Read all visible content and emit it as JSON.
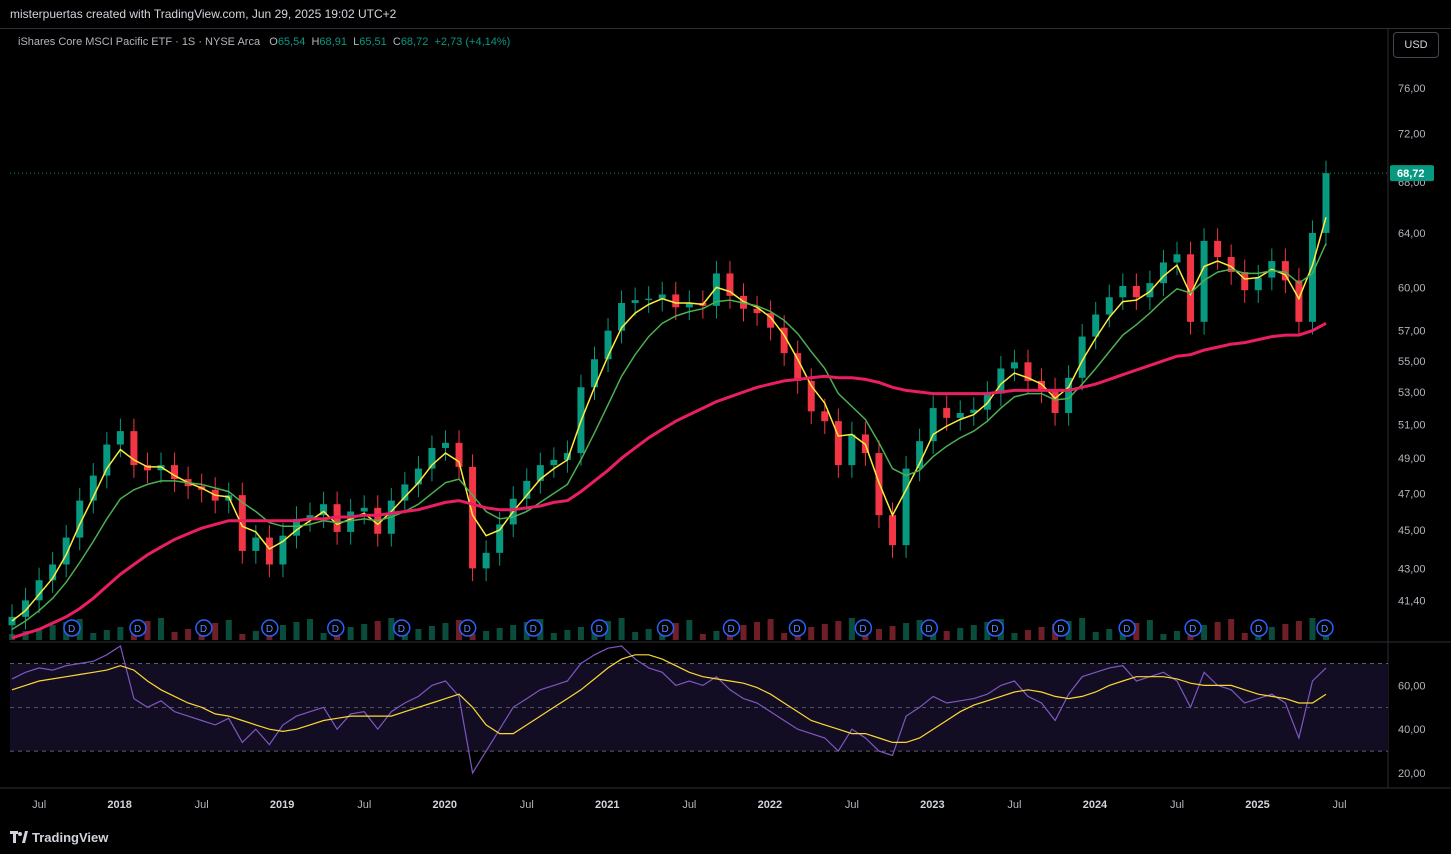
{
  "header": {
    "credit": "misterpuertas created with TradingView.com, Jun 29, 2025 19:02 UTC+2"
  },
  "legend": {
    "symbol": "iShares Core MSCI Pacific ETF · 1S · NYSE Arca",
    "open_label": "O",
    "open": "65,54",
    "high_label": "H",
    "high": "68,91",
    "low_label": "L",
    "low": "65,51",
    "close_label": "C",
    "close": "68,72",
    "change": "+2,73 (+4,14%)"
  },
  "currency": "USD",
  "footer": {
    "brand": "TradingView"
  },
  "colors": {
    "up": "#089981",
    "down": "#f23645",
    "ema_fast": "#2962ff",
    "ema_mid": "#ffeb3b",
    "ema_slow": "#4caf50",
    "ema_long": "#e91e63",
    "rsi": "#7e57c2",
    "rsi_ma": "#fdd835"
  },
  "chart_data": [
    {
      "type": "line",
      "title": "",
      "x": [
        "2017-05",
        "2017-06",
        "2017-07",
        "2017-08",
        "2017-09",
        "2017-10",
        "2017-11",
        "2017-12",
        "2018-01",
        "2018-02",
        "2018-03",
        "2018-04",
        "2018-05",
        "2018-06",
        "2018-07",
        "2018-08",
        "2018-09",
        "2018-10",
        "2018-11",
        "2018-12",
        "2019-01",
        "2019-02",
        "2019-03",
        "2019-04",
        "2019-05",
        "2019-06",
        "2019-07",
        "2019-08",
        "2019-09",
        "2019-10",
        "2019-11",
        "2019-12",
        "2020-01",
        "2020-02",
        "2020-03",
        "2020-04",
        "2020-05",
        "2020-06",
        "2020-07",
        "2020-08",
        "2020-09",
        "2020-10",
        "2020-11",
        "2020-12",
        "2021-01",
        "2021-02",
        "2021-03",
        "2021-04",
        "2021-05",
        "2021-06",
        "2021-07",
        "2021-08",
        "2021-09",
        "2021-10",
        "2021-11",
        "2021-12",
        "2022-01",
        "2022-02",
        "2022-03",
        "2022-04",
        "2022-05",
        "2022-06",
        "2022-07",
        "2022-08",
        "2022-09",
        "2022-10",
        "2022-11",
        "2022-12",
        "2023-01",
        "2023-02",
        "2023-03",
        "2023-04",
        "2023-05",
        "2023-06",
        "2023-07",
        "2023-08",
        "2023-09",
        "2023-10",
        "2023-11",
        "2023-12",
        "2024-01",
        "2024-02",
        "2024-03",
        "2024-04",
        "2024-05",
        "2024-06",
        "2024-07",
        "2024-08",
        "2024-09",
        "2024-10",
        "2024-11",
        "2024-12",
        "2025-01",
        "2025-02",
        "2025-03",
        "2025-04",
        "2025-05",
        "2025-06"
      ],
      "series": [
        {
          "name": "",
          "values": [
            40.6,
            41.4,
            42.4,
            43.2,
            44.6,
            46.6,
            48.0,
            49.8,
            50.6,
            48.6,
            48.3,
            48.6,
            47.8,
            47.4,
            47.2,
            46.6,
            46.9,
            43.9,
            44.6,
            43.2,
            44.7,
            45.6,
            45.8,
            46.4,
            44.9,
            46.0,
            46.2,
            44.8,
            46.6,
            47.5,
            48.4,
            49.6,
            49.9,
            48.5,
            43.0,
            43.8,
            45.3,
            46.7,
            47.7,
            48.6,
            48.9,
            49.3,
            53.3,
            55.1,
            57.0,
            58.9,
            59.1,
            59.2,
            59.5,
            58.6,
            58.9,
            58.7,
            61.0,
            59.4,
            58.5,
            58.2,
            57.2,
            55.5,
            53.7,
            51.8,
            51.2,
            48.6,
            50.4,
            49.3,
            45.8,
            44.2,
            48.4,
            50.0,
            52.0,
            51.4,
            51.7,
            51.9,
            52.9,
            54.5,
            54.9,
            53.7,
            53.1,
            51.7,
            53.9,
            56.6,
            58.1,
            59.3,
            60.1,
            59.3,
            60.3,
            61.8,
            62.4,
            57.6,
            63.4,
            62.2,
            61.1,
            59.8,
            60.7,
            61.9,
            60.5,
            57.6,
            64.0,
            68.7
          ]
        },
        {
          "name": "",
          "values": [
            40.4,
            40.9,
            41.7,
            42.5,
            43.7,
            45.3,
            46.8,
            48.4,
            49.5,
            48.9,
            48.5,
            48.5,
            48.0,
            47.6,
            47.3,
            46.9,
            46.8,
            45.2,
            44.9,
            44.0,
            44.4,
            45.0,
            45.5,
            46.0,
            45.3,
            45.6,
            45.9,
            45.3,
            46.0,
            46.8,
            47.6,
            48.6,
            49.3,
            48.8,
            45.8,
            44.7,
            45.0,
            46.0,
            46.9,
            47.8,
            48.4,
            48.9,
            51.2,
            53.3,
            55.3,
            57.2,
            58.2,
            58.8,
            59.2,
            58.9,
            58.9,
            58.8,
            60.0,
            59.7,
            59.0,
            58.6,
            57.9,
            56.7,
            55.1,
            53.4,
            52.3,
            50.3,
            50.4,
            49.8,
            47.6,
            45.8,
            47.2,
            48.7,
            50.4,
            50.9,
            51.3,
            51.6,
            52.3,
            53.5,
            54.2,
            53.9,
            53.5,
            52.6,
            53.3,
            55.0,
            56.5,
            57.9,
            59.0,
            59.1,
            59.7,
            60.8,
            61.6,
            59.5,
            61.5,
            61.9,
            61.5,
            60.6,
            60.7,
            61.3,
            60.9,
            59.2,
            61.6,
            65.2
          ]
        },
        {
          "name": "",
          "values": [
            40.0,
            40.4,
            40.9,
            41.5,
            42.3,
            43.3,
            44.4,
            45.6,
            46.7,
            47.2,
            47.5,
            47.7,
            47.7,
            47.6,
            47.5,
            47.3,
            47.1,
            46.5,
            46.0,
            45.4,
            45.2,
            45.2,
            45.3,
            45.5,
            45.4,
            45.5,
            45.6,
            45.5,
            45.7,
            46.0,
            46.4,
            47.0,
            47.6,
            47.8,
            46.9,
            46.0,
            45.6,
            45.7,
            46.0,
            46.5,
            47.0,
            47.5,
            48.9,
            50.5,
            52.2,
            54.0,
            55.4,
            56.6,
            57.5,
            58.0,
            58.3,
            58.5,
            59.0,
            59.1,
            58.9,
            58.7,
            58.3,
            57.7,
            56.8,
            55.6,
            54.5,
            52.9,
            52.1,
            51.3,
            49.9,
            48.4,
            48.0,
            48.3,
            49.1,
            49.7,
            50.2,
            50.6,
            51.2,
            52.0,
            52.7,
            52.9,
            52.9,
            52.5,
            52.6,
            53.5,
            54.5,
            55.6,
            56.7,
            57.4,
            58.2,
            59.1,
            59.9,
            59.6,
            60.5,
            61.1,
            61.3,
            61.0,
            61.0,
            61.2,
            61.1,
            60.3,
            61.0,
            63.2
          ]
        },
        {
          "name": "",
          "values": [
            39.6,
            39.8,
            40.0,
            40.3,
            40.6,
            41.0,
            41.5,
            42.1,
            42.7,
            43.2,
            43.7,
            44.1,
            44.5,
            44.8,
            45.1,
            45.3,
            45.5,
            45.5,
            45.5,
            45.5,
            45.5,
            45.5,
            45.6,
            45.6,
            45.7,
            45.7,
            45.8,
            45.8,
            45.9,
            46.0,
            46.1,
            46.3,
            46.5,
            46.6,
            46.4,
            46.2,
            46.1,
            46.1,
            46.2,
            46.3,
            46.5,
            46.6,
            47.1,
            47.7,
            48.3,
            49.0,
            49.6,
            50.2,
            50.7,
            51.2,
            51.6,
            52.0,
            52.4,
            52.7,
            53.0,
            53.3,
            53.5,
            53.7,
            53.8,
            53.9,
            54.0,
            53.9,
            53.9,
            53.8,
            53.6,
            53.3,
            53.1,
            53.0,
            52.9,
            52.9,
            52.9,
            52.9,
            52.9,
            53.0,
            53.1,
            53.1,
            53.1,
            53.1,
            53.1,
            53.3,
            53.5,
            53.8,
            54.1,
            54.4,
            54.7,
            55.0,
            55.3,
            55.4,
            55.7,
            55.9,
            56.1,
            56.2,
            56.4,
            56.6,
            56.7,
            56.7,
            57.0,
            57.5
          ]
        }
      ],
      "yaxis_ticks": [
        "41,40",
        "43,00",
        "45,00",
        "47,00",
        "49,00",
        "51,00",
        "53,00",
        "55,00",
        "57,00",
        "60,00",
        "64,00",
        "68,00",
        "72,00",
        "76,00"
      ],
      "last_price": "68,72",
      "xaxis_ticks": [
        "Jul",
        "2018",
        "Jul",
        "2019",
        "Jul",
        "2020",
        "Jul",
        "2021",
        "Jul",
        "2022",
        "Jul",
        "2023",
        "Jul",
        "2024",
        "Jul",
        "2025",
        "Jul"
      ],
      "dividend_marker": "D",
      "dividend_count": 20,
      "ylim": [
        39.5,
        79.5
      ],
      "grid": false,
      "scale": "log"
    },
    {
      "type": "line",
      "title": "",
      "x": [
        "2017-05",
        "2017-06",
        "2017-07",
        "2017-08",
        "2017-09",
        "2017-10",
        "2017-11",
        "2017-12",
        "2018-01",
        "2018-02",
        "2018-03",
        "2018-04",
        "2018-05",
        "2018-06",
        "2018-07",
        "2018-08",
        "2018-09",
        "2018-10",
        "2018-11",
        "2018-12",
        "2019-01",
        "2019-02",
        "2019-03",
        "2019-04",
        "2019-05",
        "2019-06",
        "2019-07",
        "2019-08",
        "2019-09",
        "2019-10",
        "2019-11",
        "2019-12",
        "2020-01",
        "2020-02",
        "2020-03",
        "2020-04",
        "2020-05",
        "2020-06",
        "2020-07",
        "2020-08",
        "2020-09",
        "2020-10",
        "2020-11",
        "2020-12",
        "2021-01",
        "2021-02",
        "2021-03",
        "2021-04",
        "2021-05",
        "2021-06",
        "2021-07",
        "2021-08",
        "2021-09",
        "2021-10",
        "2021-11",
        "2021-12",
        "2022-01",
        "2022-02",
        "2022-03",
        "2022-04",
        "2022-05",
        "2022-06",
        "2022-07",
        "2022-08",
        "2022-09",
        "2022-10",
        "2022-11",
        "2022-12",
        "2023-01",
        "2023-02",
        "2023-03",
        "2023-04",
        "2023-05",
        "2023-06",
        "2023-07",
        "2023-08",
        "2023-09",
        "2023-10",
        "2023-11",
        "2023-12",
        "2024-01",
        "2024-02",
        "2024-03",
        "2024-04",
        "2024-05",
        "2024-06",
        "2024-07",
        "2024-08",
        "2024-09",
        "2024-10",
        "2024-11",
        "2024-12",
        "2025-01",
        "2025-02",
        "2025-03",
        "2025-04",
        "2025-05",
        "2025-06"
      ],
      "series": [
        {
          "name": "",
          "values": [
            63,
            66,
            68,
            67,
            69,
            70,
            71,
            74,
            78,
            54,
            50,
            53,
            48,
            46,
            44,
            42,
            45,
            34,
            40,
            33,
            42,
            46,
            48,
            50,
            40,
            47,
            48,
            40,
            48,
            52,
            55,
            60,
            62,
            55,
            20,
            30,
            40,
            50,
            54,
            58,
            60,
            62,
            70,
            74,
            77,
            78,
            72,
            68,
            66,
            60,
            62,
            60,
            64,
            58,
            54,
            52,
            48,
            44,
            40,
            38,
            36,
            30,
            40,
            36,
            30,
            28,
            46,
            50,
            55,
            52,
            53,
            54,
            56,
            60,
            62,
            55,
            52,
            44,
            56,
            64,
            66,
            68,
            69,
            62,
            64,
            66,
            62,
            50,
            66,
            60,
            58,
            52,
            54,
            56,
            52,
            36,
            62,
            68
          ]
        },
        {
          "name": "",
          "values": [
            58,
            60,
            62,
            63,
            64,
            65,
            66,
            67,
            69,
            67,
            62,
            58,
            55,
            52,
            50,
            47,
            46,
            44,
            42,
            40,
            39,
            40,
            42,
            44,
            45,
            46,
            46,
            46,
            46,
            48,
            50,
            52,
            54,
            56,
            50,
            42,
            38,
            38,
            42,
            46,
            50,
            54,
            58,
            63,
            68,
            72,
            74,
            74,
            72,
            69,
            66,
            64,
            63,
            62,
            61,
            59,
            56,
            52,
            48,
            44,
            42,
            40,
            38,
            38,
            36,
            34,
            34,
            36,
            40,
            44,
            48,
            51,
            53,
            55,
            57,
            58,
            57,
            55,
            54,
            55,
            57,
            60,
            62,
            64,
            64,
            64,
            63,
            61,
            60,
            60,
            60,
            58,
            56,
            55,
            54,
            52,
            52,
            56
          ]
        }
      ],
      "yaxis_ticks": [
        "20,00",
        "40,00",
        "60,00"
      ],
      "levels": [
        70,
        50,
        30
      ],
      "ylim": [
        15,
        78
      ]
    }
  ]
}
